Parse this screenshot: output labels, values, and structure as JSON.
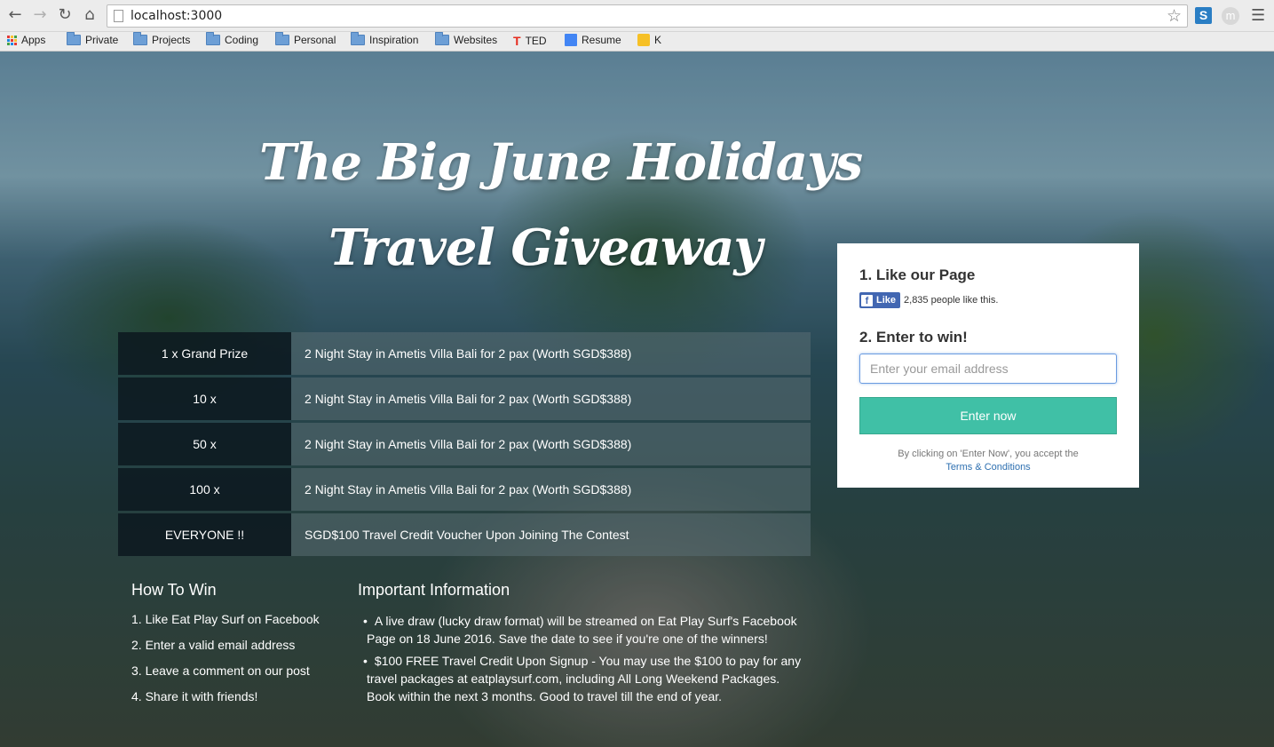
{
  "browser": {
    "url": "localhost:3000",
    "bookmarks": [
      {
        "label": "Apps",
        "icon": "apps-icon"
      },
      {
        "label": "Private",
        "icon": "folder-icon"
      },
      {
        "label": "Projects",
        "icon": "folder-icon"
      },
      {
        "label": "Coding",
        "icon": "folder-icon"
      },
      {
        "label": "Personal",
        "icon": "folder-icon"
      },
      {
        "label": "Inspiration",
        "icon": "folder-icon"
      },
      {
        "label": "Websites",
        "icon": "folder-icon"
      },
      {
        "label": "TED",
        "icon": "ted-icon"
      },
      {
        "label": "Resume",
        "icon": "doc-icon"
      },
      {
        "label": "K",
        "icon": "k-icon"
      }
    ],
    "ext_s": "S",
    "ext_m": "m"
  },
  "hero": {
    "title_line1": "The Big June Holidays",
    "title_line2": "Travel Giveaway"
  },
  "prizes": [
    {
      "qty": "1 x Grand Prize",
      "desc": "2 Night Stay in Ametis Villa Bali for 2 pax (Worth SGD$388)"
    },
    {
      "qty": "10 x",
      "desc": "2 Night Stay in Ametis Villa Bali for 2 pax (Worth SGD$388)"
    },
    {
      "qty": "50 x",
      "desc": "2 Night Stay in Ametis Villa Bali for 2 pax (Worth SGD$388)"
    },
    {
      "qty": "100 x",
      "desc": "2 Night Stay in Ametis Villa Bali for 2 pax (Worth SGD$388)"
    },
    {
      "qty": "EVERYONE !!",
      "desc": "SGD$100 Travel Credit Voucher Upon Joining The Contest"
    }
  ],
  "how_to_win": {
    "heading": "How To Win",
    "steps": [
      "1. Like Eat Play Surf on Facebook",
      "2. Enter a valid email address",
      "3. Leave a comment on our post",
      "4. Share it with friends!"
    ]
  },
  "important": {
    "heading": "Important Information",
    "items": [
      "A live draw (lucky draw format) will be streamed on Eat Play Surf's Facebook Page on 18 June 2016. Save the date to see if you're one of the winners!",
      "$100 FREE Travel Credit Upon Signup - You may use the $100 to pay for any travel packages at eatplaysurf.com, including All Long Weekend Packages. Book within the next 3 months. Good to travel till the end of year."
    ]
  },
  "entry": {
    "like_heading": "1. Like our Page",
    "fb_like_label": "Like",
    "fb_like_count": "2,835 people like this.",
    "enter_heading": "2. Enter to win!",
    "email_placeholder": "Enter your email address",
    "submit_label": "Enter now",
    "terms_text": "By clicking on 'Enter Now', you accept the",
    "terms_link": "Terms & Conditions"
  },
  "colors": {
    "accent": "#40c0a6",
    "facebook": "#4267b2",
    "link": "#2d6fb0"
  }
}
